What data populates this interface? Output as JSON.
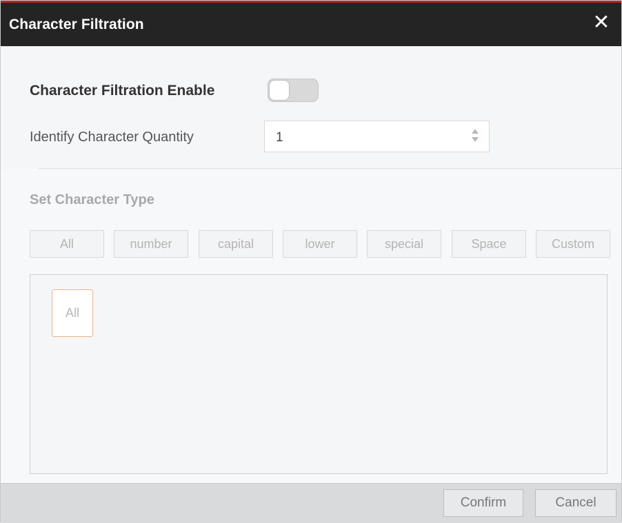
{
  "dialog": {
    "title": "Character Filtration",
    "close_icon": "close-icon"
  },
  "settings": {
    "enable_label": "Character Filtration Enable",
    "enable_state": false,
    "quantity_label": "Identify Character Quantity",
    "quantity_value": "1"
  },
  "character_type": {
    "title": "Set Character Type",
    "buttons": [
      {
        "label": "All"
      },
      {
        "label": "number"
      },
      {
        "label": "capital"
      },
      {
        "label": "lower"
      },
      {
        "label": "special"
      },
      {
        "label": "Space"
      },
      {
        "label": "Custom"
      }
    ],
    "selected_chips": [
      {
        "label": "All"
      }
    ]
  },
  "footer": {
    "confirm_label": "Confirm",
    "cancel_label": "Cancel"
  },
  "colors": {
    "titlebar": "#242424",
    "title_accent": "#b3262b",
    "chip_border": "#e8b58a"
  }
}
